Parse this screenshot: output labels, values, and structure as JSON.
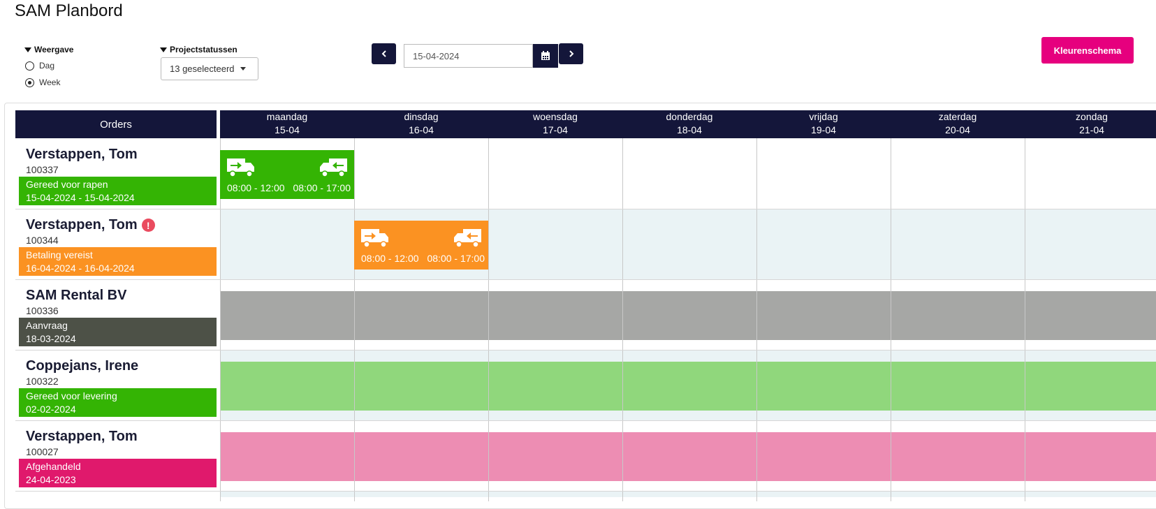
{
  "app": {
    "title": "SAM Planbord"
  },
  "view": {
    "label": "Weergave",
    "options": [
      {
        "label": "Dag",
        "selected": false
      },
      {
        "label": "Week",
        "selected": true
      }
    ]
  },
  "statuses": {
    "label": "Projectstatussen",
    "selected": "13 geselecteerd"
  },
  "date": {
    "value": "15-04-2024"
  },
  "buttons": {
    "color_scheme": "Kleurenschema"
  },
  "grid": {
    "orders_header": "Orders",
    "days": [
      {
        "day": "maandag",
        "date": "15-04"
      },
      {
        "day": "dinsdag",
        "date": "16-04"
      },
      {
        "day": "woensdag",
        "date": "17-04"
      },
      {
        "day": "donderdag",
        "date": "18-04"
      },
      {
        "day": "vrijdag",
        "date": "19-04"
      },
      {
        "day": "zaterdag",
        "date": "20-04"
      },
      {
        "day": "zondag",
        "date": "21-04"
      }
    ]
  },
  "orders": [
    {
      "name": "Verstappen, Tom",
      "number": "100337",
      "status": "Gereed voor rapen",
      "period": "15-04-2024 - 15-04-2024",
      "status_color": "#34b404",
      "warning": false,
      "card": {
        "color": "#34b404",
        "day_index": 0,
        "out_time": "08:00 - 12:00",
        "in_time": "08:00 - 17:00"
      }
    },
    {
      "name": "Verstappen, Tom",
      "number": "100344",
      "status": "Betaling vereist",
      "period": "16-04-2024 - 16-04-2024",
      "status_color": "#fb9222",
      "warning": true,
      "warning_symbol": "!",
      "card": {
        "color": "#fb9222",
        "day_index": 1,
        "out_time": "08:00 - 12:00",
        "in_time": "08:00 - 17:00"
      }
    },
    {
      "name": "SAM Rental BV",
      "number": "100336",
      "status": "Aanvraag",
      "period": "18-03-2024",
      "status_color": "#4d5147",
      "warning": false,
      "bar_color": "#a6a7a5"
    },
    {
      "name": "Coppejans, Irene",
      "number": "100322",
      "status": "Gereed voor levering",
      "period": "02-02-2024",
      "status_color": "#34b404",
      "warning": false,
      "bar_color": "#90d77c"
    },
    {
      "name": "Verstappen, Tom",
      "number": "100027",
      "status": "Afgehandeld",
      "period": "24-04-2023",
      "status_color": "#e0196c",
      "warning": false,
      "bar_color": "#ed8db3"
    }
  ],
  "icons": {
    "delivery": "truck-delivery-icon",
    "pickup": "truck-pickup-icon",
    "calendar": "calendar-icon",
    "warning": "warning-icon"
  }
}
